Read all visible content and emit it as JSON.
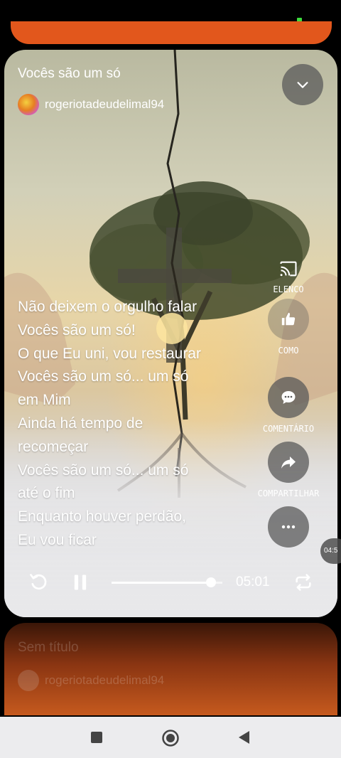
{
  "player": {
    "title": "Vocês são um só",
    "author": "rogeriotadeudelimal94",
    "lyrics": [
      "Não deixem o orgulho falar",
      "Vocês são um só!",
      "O que Eu uni, vou restaurar",
      "Vocês são um só... um só",
      "em Mim",
      "Ainda há tempo de",
      "recomeçar",
      "Vocês são um só... um só",
      "até o fim",
      "Enquanto houver perdão,",
      "Eu vou ficar"
    ],
    "actions": {
      "cast": {
        "label": "ELENCO",
        "icon": "cast-icon"
      },
      "like": {
        "label": "COMO",
        "icon": "thumbs-up-icon"
      },
      "comment": {
        "label": "COMENTÁRIO",
        "icon": "comment-icon"
      },
      "share": {
        "label": "COMPARTILHAR",
        "icon": "share-icon"
      },
      "more": {
        "icon": "more-icon"
      }
    },
    "duration": "05:01",
    "progress": 0.9,
    "side_timer": "04:5"
  },
  "next_item": {
    "title": "Sem título",
    "author": "rogeriotadeudelimal94"
  },
  "colors": {
    "accent_orange": "#e2571c",
    "overlay_button": "#5a5a5a"
  }
}
